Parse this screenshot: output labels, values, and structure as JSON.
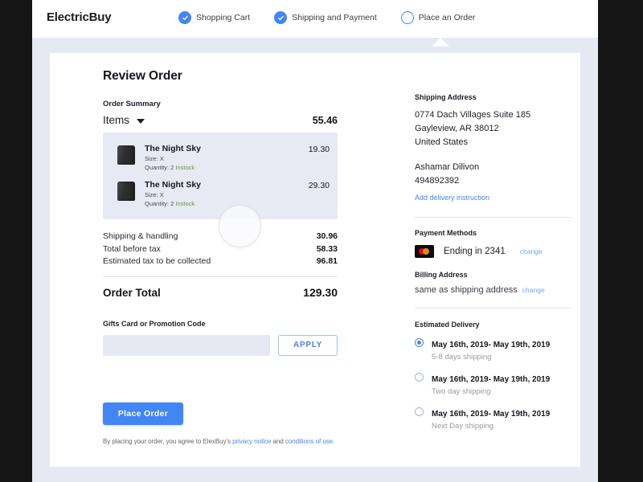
{
  "brand": "ElectricBuy",
  "steps": [
    {
      "label": "Shopping Cart",
      "state": "done",
      "icon": "check-circle-icon"
    },
    {
      "label": "Shipping and Payment",
      "state": "done",
      "icon": "check-circle-icon"
    },
    {
      "label": "Place an Order",
      "state": "todo",
      "icon": "empty-circle-icon"
    }
  ],
  "main": {
    "page_title": "Review Order",
    "order_summary_label": "Order Summary",
    "items_label": "Items",
    "items_total": "55.46",
    "items": [
      {
        "name": "The Night Sky",
        "size": "Size: X",
        "quantity": "Quantity: 2",
        "stock": "Instock",
        "price": "19.30"
      },
      {
        "name": "The Night Sky",
        "size": "Size: X",
        "quantity": "Quantity: 2",
        "stock": "Instock",
        "price": "29.30"
      }
    ],
    "totals": [
      {
        "label": "Shipping & handling",
        "amount": "30.96"
      },
      {
        "label": "Total before tax",
        "amount": "58.33"
      },
      {
        "label": "Estimated tax to be collected",
        "amount": "96.81"
      }
    ],
    "order_total_label": "Order Total",
    "order_total_amount": "129.30",
    "promo_label": "Gifts Card or Promotion Code",
    "promo_value": "",
    "promo_placeholder": "",
    "apply_label": "APPLY",
    "place_order_label": "Place Order",
    "legal": {
      "prefix": "By placing your order, you agree to ElexBuy's ",
      "link1": "privacy notice",
      "middle": " and ",
      "link2": "conditions of use",
      "suffix": "."
    }
  },
  "sidebar": {
    "shipping_head": "Shipping Address",
    "address_lines": [
      "0774 Dach Villages Suite 185",
      "Gayleview, AR 38012",
      "United States"
    ],
    "recipient_name": "Ashamar Dilivon",
    "recipient_phone": "494892392",
    "add_delivery_link": "Add delivery instruction",
    "payment_head": "Payment Methods",
    "card_ending": "Ending in 2341",
    "card_change": "change",
    "card_logo": "mastercard-icon",
    "billing_head": "Billing Address",
    "billing_text": "same as shipping address",
    "billing_change": "change",
    "delivery_head": "Estimated Delivery",
    "delivery_options": [
      {
        "date": "May 16th, 2019- May 19th, 2019",
        "sub": "5-8 days shipping",
        "selected": true
      },
      {
        "date": "May 16th, 2019- May 19th, 2019",
        "sub": "Two day shipping",
        "selected": false
      },
      {
        "date": "May 16th, 2019- May 19th, 2019",
        "sub": "Next Day shipping",
        "selected": false
      }
    ]
  },
  "colors": {
    "accent": "#4285f4",
    "page_bg": "#e6e9f2",
    "card_bg": "#ffffff",
    "item_bg": "#e7eaf3",
    "stock_green": "#5a9a43",
    "frame": "#151515"
  }
}
